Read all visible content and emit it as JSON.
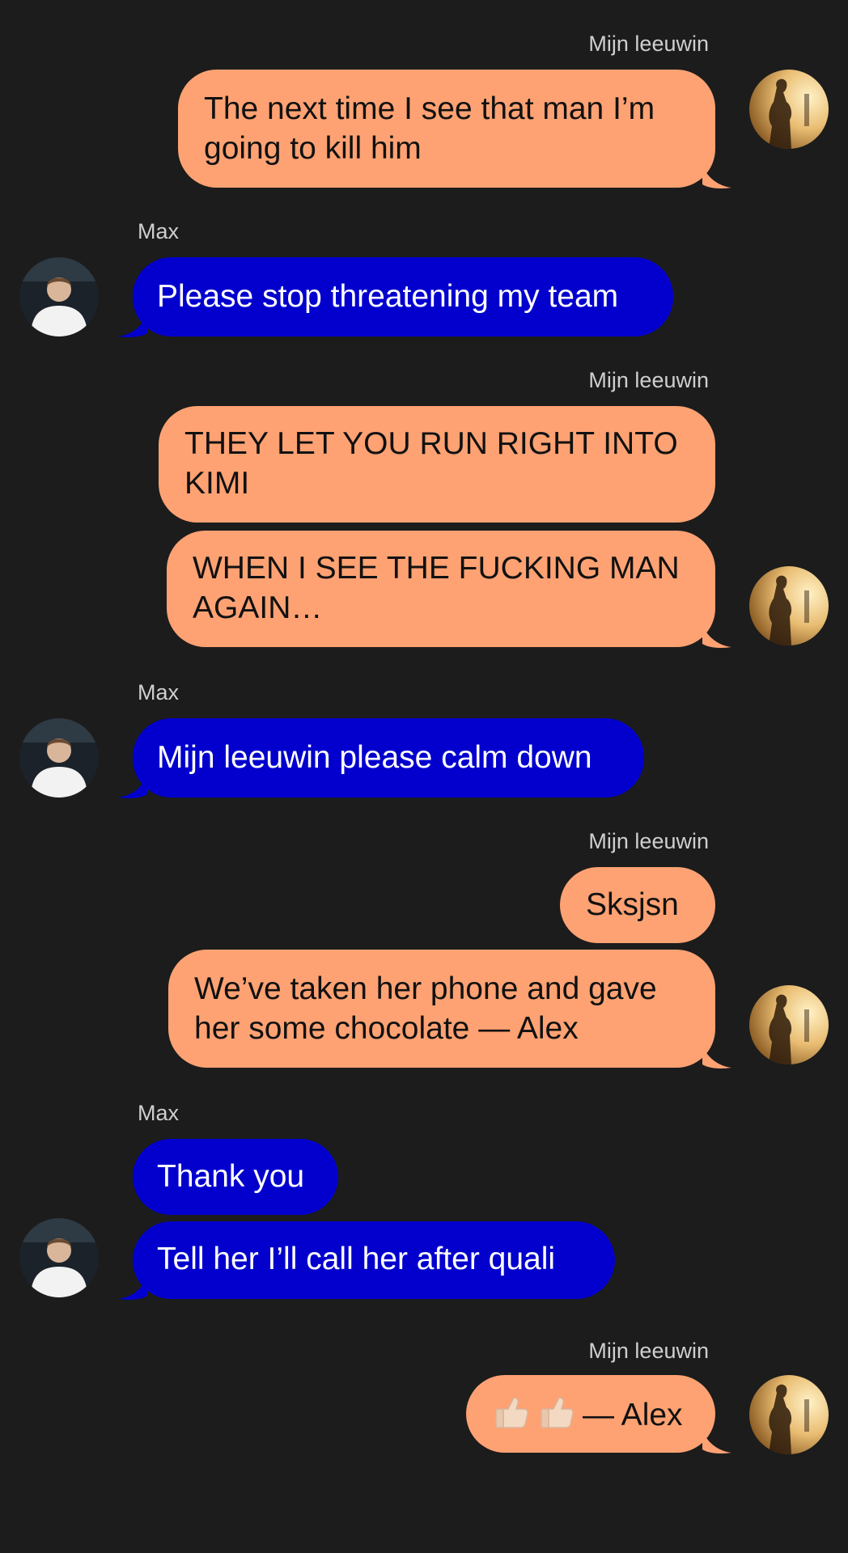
{
  "sender_labels": {
    "me": "Mijn leeuwin",
    "them": "Max"
  },
  "messages": [
    {
      "from": "me",
      "lines": [
        "The next time I see that man I’m",
        "going to kill him"
      ]
    },
    {
      "from": "them",
      "lines": [
        "Please stop threatening my team"
      ]
    },
    {
      "from": "me",
      "lines": [
        "THEY LET YOU RUN RIGHT INTO",
        "KIMI"
      ]
    },
    {
      "from": "me",
      "lines": [
        "WHEN I SEE THE FUCKING MAN",
        "AGAIN…"
      ]
    },
    {
      "from": "them",
      "lines": [
        "Mijn leeuwin please calm down"
      ]
    },
    {
      "from": "me",
      "lines": [
        "Sksjsn"
      ]
    },
    {
      "from": "me",
      "lines": [
        "We’ve taken her phone and gave",
        "her some chocolate — Alex"
      ]
    },
    {
      "from": "them",
      "lines": [
        "Thank you"
      ]
    },
    {
      "from": "them",
      "lines": [
        "Tell her I’ll call her after quali"
      ]
    },
    {
      "from": "me",
      "emoji": [
        "thumbs-up-icon",
        "thumbs-up-icon"
      ],
      "text": "— Alex"
    }
  ],
  "colors": {
    "background": "#1c1c1c",
    "me_bubble": "#fea273",
    "them_bubble": "#0300cd"
  }
}
